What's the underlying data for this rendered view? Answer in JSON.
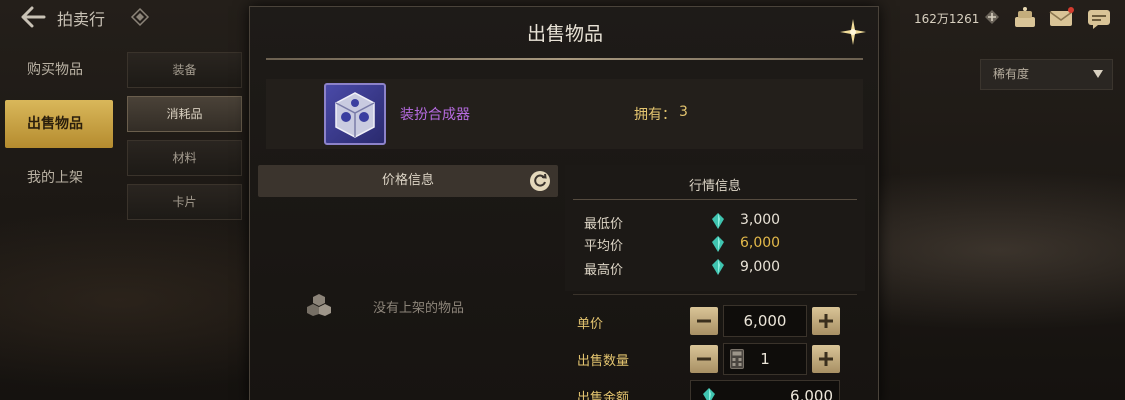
{
  "topbar": {
    "title": "拍卖行",
    "currency": "162万1261",
    "icons": [
      "back-arrow-icon",
      "diamond-icon",
      "plus-icon",
      "cake-icon",
      "mail-icon",
      "chat-icon"
    ]
  },
  "left_menu": {
    "items": [
      {
        "label": "购买物品",
        "active": false
      },
      {
        "label": "出售物品",
        "active": true
      },
      {
        "label": "我的上架",
        "active": false
      }
    ]
  },
  "sub_menu": {
    "items": [
      {
        "label": "装备",
        "active": false
      },
      {
        "label": "消耗品",
        "active": true
      },
      {
        "label": "材料",
        "active": false
      },
      {
        "label": "卡片",
        "active": false
      }
    ]
  },
  "sort_dropdown": {
    "selected": "稀有度"
  },
  "dialog": {
    "title": "出售物品",
    "item": {
      "name": "装扮合成器",
      "own_label": "拥有：",
      "own_count": "3"
    },
    "price_info": {
      "header": "价格信息",
      "empty_text": "没有上架的物品"
    },
    "market_info": {
      "header": "行情信息",
      "rows": [
        {
          "label": "最低价",
          "value": "3,000",
          "highlight": false
        },
        {
          "label": "平均价",
          "value": "6,000",
          "highlight": true
        },
        {
          "label": "最高价",
          "value": "9,000",
          "highlight": false
        }
      ]
    },
    "form": {
      "unit_price_label": "单价",
      "unit_price": "6,000",
      "quantity_label": "出售数量",
      "quantity": "1",
      "total_label": "出售金额",
      "total": "6,000"
    }
  },
  "colors": {
    "gold_accent": "#e3c46f",
    "active_tab": "#d9b75a",
    "item_name": "#b66be0",
    "highlight_value": "#e3b94a",
    "gem": "#3fc4b0"
  }
}
